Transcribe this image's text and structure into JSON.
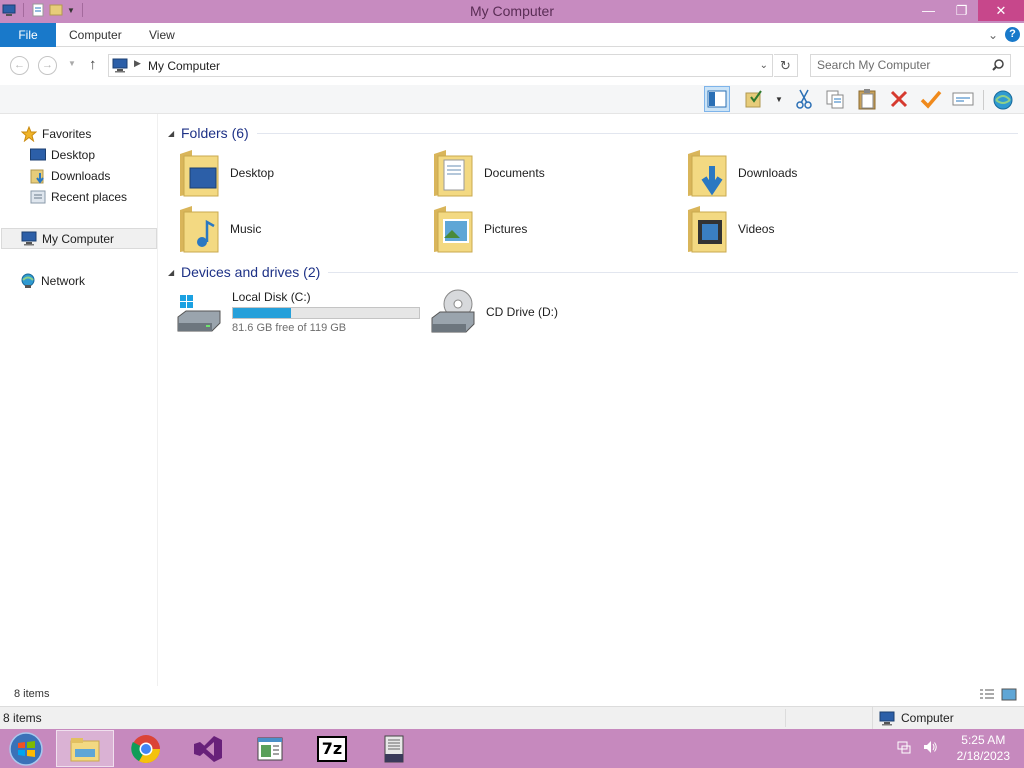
{
  "window": {
    "title": "My Computer",
    "controls": {
      "minimize": "—",
      "restore": "❐",
      "close": "✕"
    }
  },
  "ribbon": {
    "file_tab": "File",
    "tabs": [
      "Computer",
      "View"
    ]
  },
  "address_bar": {
    "path": "My Computer",
    "search_placeholder": "Search My Computer"
  },
  "sidebar": {
    "favorites": {
      "label": "Favorites",
      "items": [
        {
          "label": "Desktop",
          "icon": "desktop-icon"
        },
        {
          "label": "Downloads",
          "icon": "downloads-icon"
        },
        {
          "label": "Recent places",
          "icon": "recent-places-icon"
        }
      ]
    },
    "computer": {
      "label": "My Computer",
      "selected": true
    },
    "network": {
      "label": "Network"
    }
  },
  "content": {
    "folders_header": "Folders (6)",
    "folders": [
      {
        "name": "Desktop",
        "icon": "desktop-folder-icon"
      },
      {
        "name": "Documents",
        "icon": "documents-folder-icon"
      },
      {
        "name": "Downloads",
        "icon": "downloads-folder-icon"
      },
      {
        "name": "Music",
        "icon": "music-folder-icon"
      },
      {
        "name": "Pictures",
        "icon": "pictures-folder-icon"
      },
      {
        "name": "Videos",
        "icon": "videos-folder-icon"
      }
    ],
    "drives_header": "Devices and drives (2)",
    "drives": [
      {
        "name": "Local Disk (C:)",
        "free_text": "81.6 GB free of 119 GB",
        "used_fraction": 0.31
      },
      {
        "name": "CD Drive (D:)"
      }
    ]
  },
  "status": {
    "item_count": "8 items",
    "item_count_bottom": "8 items",
    "zone": "Computer"
  },
  "taskbar": {
    "apps": [
      "file-explorer",
      "chrome",
      "visual-studio",
      "notepad",
      "7-zip",
      "archive"
    ],
    "seven_zip_label": "7z",
    "time": "5:25 AM",
    "date": "2/18/2023"
  },
  "colors": {
    "titlebar": "#c78bc0",
    "taskbar": "#c689be",
    "file_tab": "#1979ca",
    "group_header": "#1e3287",
    "progress_fill": "#26a0da"
  }
}
